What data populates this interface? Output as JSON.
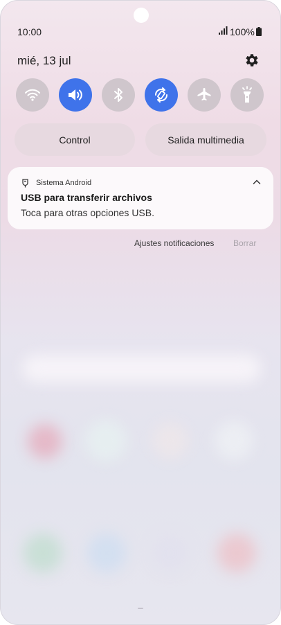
{
  "status": {
    "time": "10:00",
    "battery": "100%"
  },
  "header": {
    "date": "mié, 13 jul",
    "settings_icon": "gear-icon"
  },
  "quick_tiles": [
    {
      "name": "wifi",
      "icon": "wifi-icon",
      "state": "off"
    },
    {
      "name": "sound",
      "icon": "volume-icon",
      "state": "on"
    },
    {
      "name": "bluetooth",
      "icon": "bluetooth-icon",
      "state": "off"
    },
    {
      "name": "auto-rotate",
      "icon": "rotate-icon",
      "state": "on"
    },
    {
      "name": "airplane",
      "icon": "airplane-icon",
      "state": "off"
    },
    {
      "name": "flashlight",
      "icon": "flashlight-icon",
      "state": "off"
    }
  ],
  "buttons": {
    "control": "Control",
    "media_output": "Salida multimedia"
  },
  "notification": {
    "app": "Sistema Android",
    "title": "USB para transferir archivos",
    "text": "Toca para otras opciones USB."
  },
  "notification_actions": {
    "settings": "Ajustes notificaciones",
    "clear": "Borrar"
  },
  "colors": {
    "accent": "#3f73ea",
    "tile_off": "#cfc6cc"
  }
}
